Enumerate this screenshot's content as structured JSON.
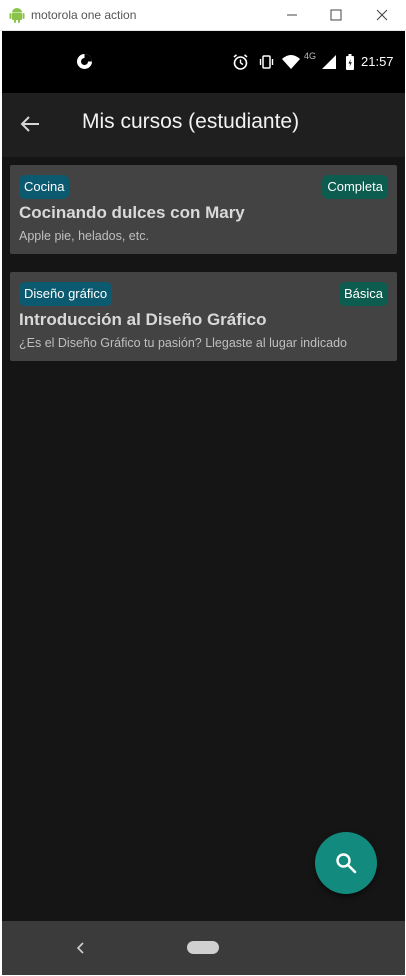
{
  "window": {
    "title": "motorola one action",
    "icon": "android-icon"
  },
  "status_bar": {
    "time": "21:57",
    "network": "4G",
    "icons": [
      "notification-icon",
      "alarm-icon",
      "vibrate-icon",
      "wifi-icon",
      "signal-icon",
      "battery-icon"
    ]
  },
  "app_bar": {
    "title": "Mis cursos (estudiante)",
    "back_icon": "arrow-back-icon"
  },
  "courses": [
    {
      "category": "Cocina",
      "level": "Completa",
      "title": "Cocinando dulces con Mary",
      "description": "Apple pie, helados, etc."
    },
    {
      "category": "Diseño gráfico",
      "level": "Básica",
      "title": "Introducción al Diseño Gráfico",
      "description": "¿Es el Diseño Gráfico tu pasión? Llegaste al lugar indicado"
    }
  ],
  "fab": {
    "icon": "search-icon"
  },
  "colors": {
    "background": "#151515",
    "app_bar": "#1f1f1f",
    "card": "#434343",
    "category_chip": "#0b5a6f",
    "level_chip": "#0c5c4f",
    "fab": "#128a7d"
  }
}
